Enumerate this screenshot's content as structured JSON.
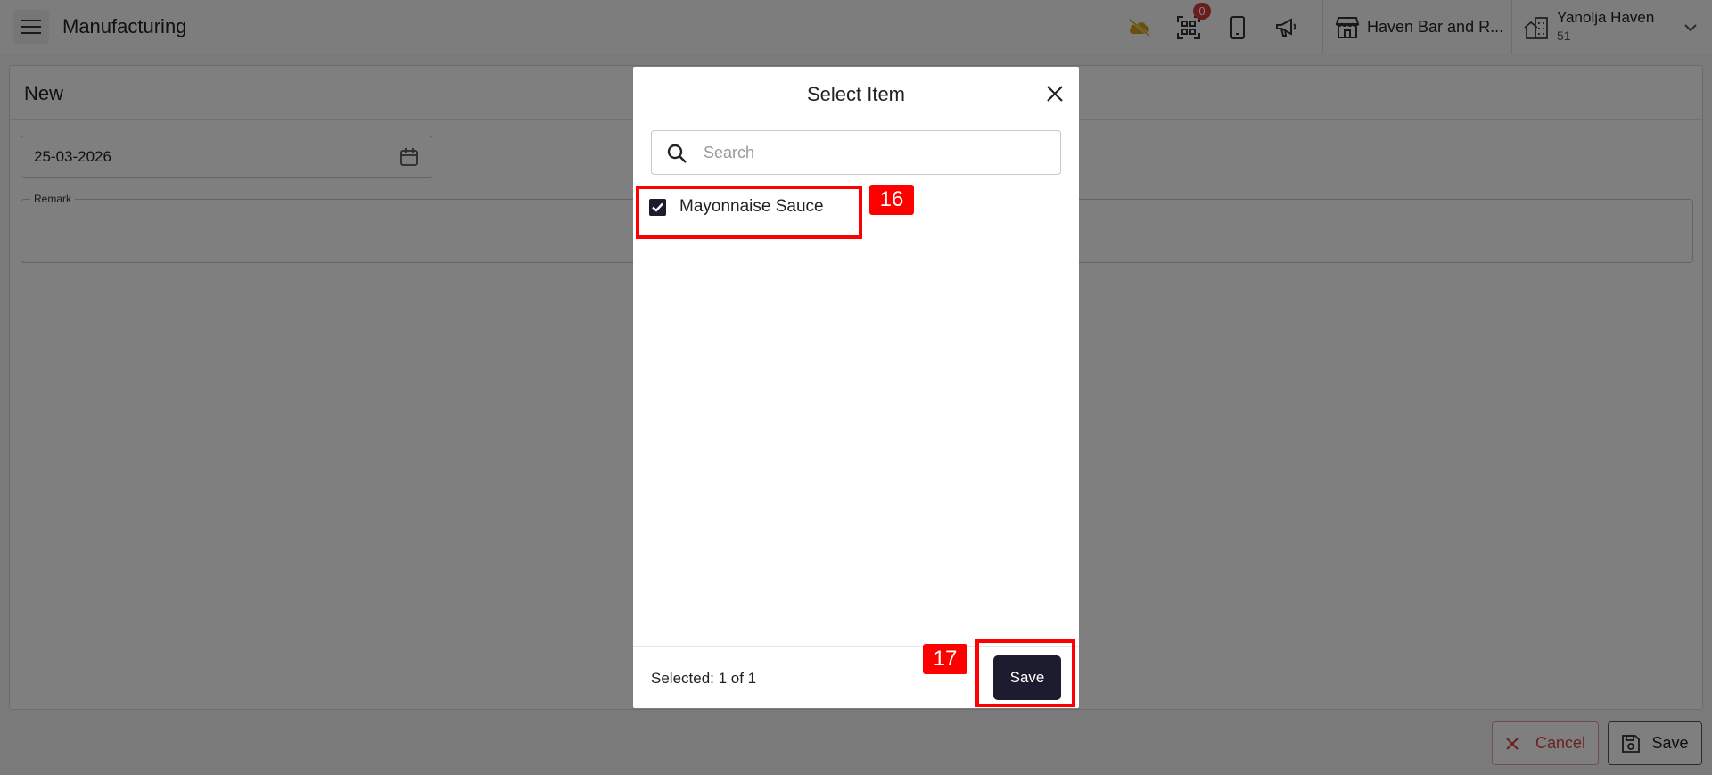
{
  "header": {
    "title": "Manufacturing",
    "notification_count": "0",
    "outlet_name": "Haven Bar and R...",
    "user_name": "Yanolja Haven",
    "user_sub": "51"
  },
  "form": {
    "title": "New",
    "date_value": "25-03-2026",
    "remark_label": "Remark",
    "cancel_label": "Cancel",
    "save_label": "Save"
  },
  "modal": {
    "title": "Select Item",
    "search_placeholder": "Search",
    "items": [
      {
        "label": "Mayonnaise Sauce",
        "checked": true
      }
    ],
    "selected_text": "Selected: 1 of 1",
    "save_label": "Save"
  },
  "annotations": {
    "item_marker": "16",
    "save_marker": "17"
  },
  "colors": {
    "primary": "#1d1b2e",
    "danger": "#d24545",
    "badge": "#d23b3b",
    "annotation": "#ff0000",
    "cloud_icon": "#d4a017"
  }
}
